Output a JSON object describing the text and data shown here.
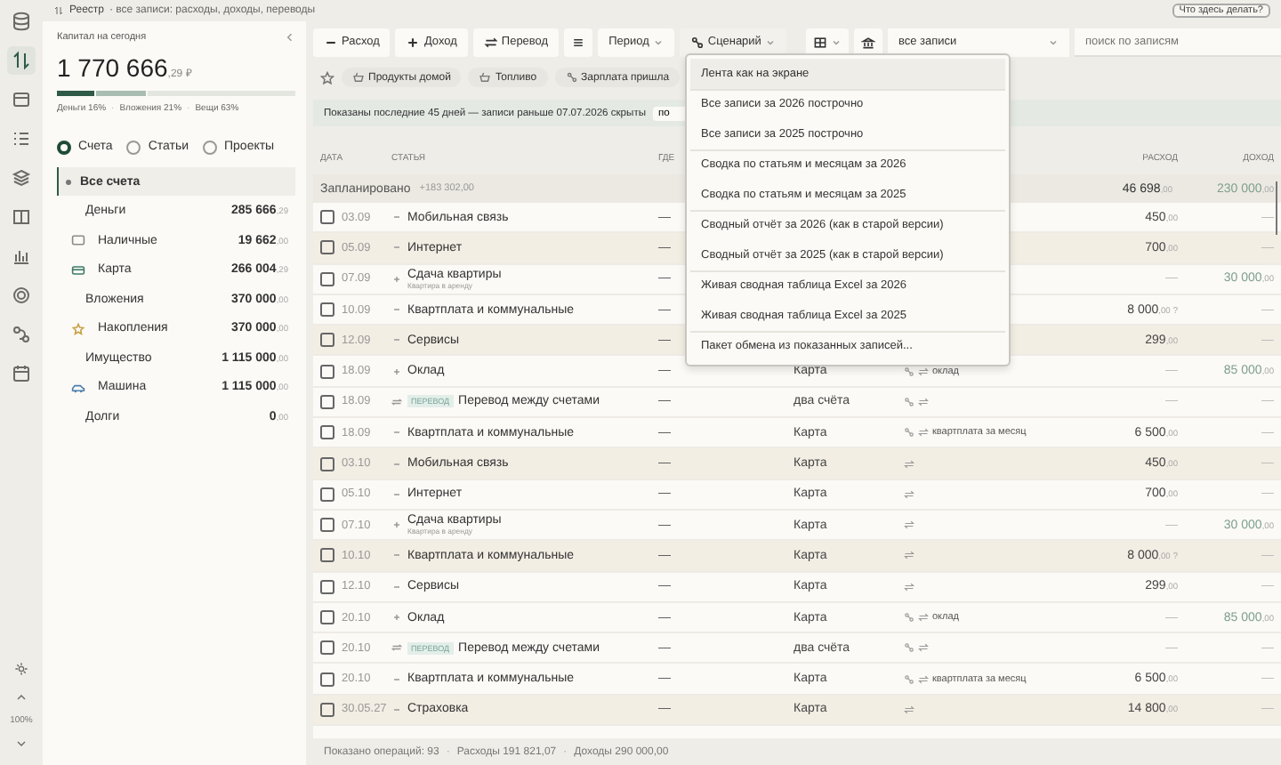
{
  "header": {
    "title": "Реестр",
    "subtitle": "· все записи: расходы, доходы, переводы",
    "help_button": "Что здесь делать?"
  },
  "rail": {
    "items": [
      {
        "selected": false
      },
      {
        "selected": true
      },
      {
        "selected": false
      },
      {
        "selected": false
      },
      {
        "selected": false
      },
      {
        "selected": false
      },
      {
        "selected": false
      },
      {
        "selected": false
      },
      {
        "selected": false
      },
      {
        "selected": false
      }
    ],
    "zoom": "100%"
  },
  "separator": "·",
  "capital": {
    "label": "Капитал на сегодня",
    "amount": "1 770 666",
    "cents": ",29 ₽",
    "segments": [
      {
        "label": "Деньги 16%",
        "level": 0.16,
        "color": "#2f5a48"
      },
      {
        "label": "Вложения 21%",
        "level": 0.21,
        "color": "#a9bdb2"
      },
      {
        "label": "Вещи 63%",
        "level": 0.63,
        "color": "#e3e6df"
      }
    ]
  },
  "views": [
    {
      "label": "Счета",
      "selected": true
    },
    {
      "label": "Статьи",
      "selected": false
    },
    {
      "label": "Проекты",
      "selected": false
    }
  ],
  "accounts": [
    {
      "label": "Все счета",
      "selected": true,
      "kind": "all"
    },
    {
      "label": "Деньги",
      "amount": "285 666",
      "cents": ",29",
      "selected": false,
      "kind": "group",
      "children": [
        {
          "label": "Наличные",
          "amount": "19 662",
          "cents": ",00",
          "selected": false,
          "kind": "cash"
        },
        {
          "label": "Карта",
          "amount": "266 004",
          "cents": ",29",
          "selected": false,
          "kind": "card"
        }
      ]
    },
    {
      "label": "Вложения",
      "amount": "370 000",
      "cents": ",00",
      "selected": false,
      "kind": "group",
      "children": [
        {
          "label": "Накопления",
          "amount": "370 000",
          "cents": ",00",
          "selected": false,
          "kind": "savings"
        }
      ]
    },
    {
      "label": "Имущество",
      "amount": "1 115 000",
      "cents": ",00",
      "selected": false,
      "kind": "group",
      "children": [
        {
          "label": "Машина",
          "amount": "1 115 000",
          "cents": ",00",
          "selected": false,
          "kind": "car"
        }
      ]
    },
    {
      "label": "Долги",
      "amount": "0",
      "cents": ",00",
      "selected": false,
      "kind": "group"
    }
  ],
  "toolbar": {
    "expense": "Расход",
    "income": "Доход",
    "transfer": "Перевод",
    "period": "Период",
    "scenario": "Сценарий",
    "filter": "все записи",
    "search_placeholder": "поиск по записям"
  },
  "favorites": [
    {
      "label": "Продукты домой",
      "kind": "basket"
    },
    {
      "label": "Топливо",
      "kind": "basket"
    },
    {
      "label": "Зарплата пришла",
      "kind": "link"
    }
  ],
  "notice": {
    "text": "Показаны последние 45 дней — записи раньше 07.07.2026 скрыты",
    "button": "по"
  },
  "table": {
    "columns": [
      "ДАТА",
      "СТАТЬЯ",
      "ГДЕ",
      "РАСХОД",
      "ДОХОД"
    ],
    "group": {
      "label": "Запланировано",
      "total": "+183 302,00",
      "expense": {
        "whole": "46 698",
        "cents": ",00"
      },
      "income": {
        "whole": "230 000",
        "cents": ",00"
      }
    },
    "rows": [
      {
        "date": "03.09",
        "kind": "expense",
        "title": "Мобильная связь",
        "where": "—",
        "shaded": false,
        "expense": {
          "whole": "450",
          "cents": ",00"
        },
        "income": {
          "whole": "—"
        }
      },
      {
        "date": "05.09",
        "kind": "expense",
        "title": "Интернет",
        "where": "—",
        "shaded": true,
        "expense": {
          "whole": "700",
          "cents": ",00"
        },
        "income": {
          "whole": "—"
        }
      },
      {
        "date": "07.09",
        "kind": "income",
        "title": "Сдача квартиры",
        "note": "Квартира в аренду",
        "where": "—",
        "shaded": false,
        "expense": {
          "whole": "—"
        },
        "income": {
          "whole": "30 000",
          "cents": ",00"
        }
      },
      {
        "date": "10.09",
        "kind": "expense",
        "title": "Квартплата и коммунальные",
        "where": "—",
        "shaded": false,
        "expense": {
          "whole": "8 000",
          "cents": ",00",
          "mark": "?"
        },
        "income": {
          "whole": "—"
        }
      },
      {
        "date": "12.09",
        "kind": "expense",
        "title": "Сервисы",
        "where": "—",
        "shaded": true,
        "expense": {
          "whole": "299",
          "cents": ",00"
        },
        "income": {
          "whole": "—"
        }
      },
      {
        "date": "18.09",
        "kind": "income",
        "title": "Оклад",
        "where": "—",
        "account": "Карта",
        "linked": true,
        "recurring": true,
        "tag": "оклад",
        "shaded": false,
        "expense": {
          "whole": "—"
        },
        "income": {
          "whole": "85 000",
          "cents": ",00"
        }
      },
      {
        "date": "18.09",
        "kind": "transfer",
        "badge": "ПЕРЕВОД",
        "title": "Перевод между счетами",
        "where": "—",
        "account": "два счёта",
        "linked": true,
        "recurring": true,
        "shaded": false,
        "expense": {
          "whole": "—"
        },
        "income": {
          "whole": "—"
        }
      },
      {
        "date": "18.09",
        "kind": "expense",
        "title": "Квартплата и коммунальные",
        "where": "—",
        "account": "Карта",
        "linked": true,
        "recurring": true,
        "tag": "квартплата за месяц",
        "shaded": false,
        "expense": {
          "whole": "6 500",
          "cents": ",00"
        },
        "income": {
          "whole": "—"
        }
      },
      {
        "date": "03.10",
        "kind": "expense",
        "title": "Мобильная связь",
        "where": "—",
        "account": "Карта",
        "linked": false,
        "recurring": true,
        "shaded": true,
        "expense": {
          "whole": "450",
          "cents": ",00"
        },
        "income": {
          "whole": "—"
        }
      },
      {
        "date": "05.10",
        "kind": "expense",
        "title": "Интернет",
        "where": "—",
        "account": "Карта",
        "linked": false,
        "recurring": true,
        "shaded": false,
        "expense": {
          "whole": "700",
          "cents": ",00"
        },
        "income": {
          "whole": "—"
        }
      },
      {
        "date": "07.10",
        "kind": "income",
        "title": "Сдача квартиры",
        "note": "Квартира в аренду",
        "where": "—",
        "account": "Карта",
        "linked": false,
        "recurring": true,
        "shaded": false,
        "expense": {
          "whole": "—"
        },
        "income": {
          "whole": "30 000",
          "cents": ",00"
        }
      },
      {
        "date": "10.10",
        "kind": "expense",
        "title": "Квартплата и коммунальные",
        "where": "—",
        "account": "Карта",
        "linked": false,
        "recurring": true,
        "shaded": true,
        "expense": {
          "whole": "8 000",
          "cents": ",00",
          "mark": "?"
        },
        "income": {
          "whole": "—"
        }
      },
      {
        "date": "12.10",
        "kind": "expense",
        "title": "Сервисы",
        "where": "—",
        "account": "Карта",
        "linked": false,
        "recurring": true,
        "shaded": false,
        "expense": {
          "whole": "299",
          "cents": ",00"
        },
        "income": {
          "whole": "—"
        }
      },
      {
        "date": "20.10",
        "kind": "income",
        "title": "Оклад",
        "where": "—",
        "account": "Карта",
        "linked": true,
        "recurring": true,
        "tag": "оклад",
        "shaded": false,
        "expense": {
          "whole": "—"
        },
        "income": {
          "whole": "85 000",
          "cents": ",00"
        }
      },
      {
        "date": "20.10",
        "kind": "transfer",
        "badge": "ПЕРЕВОД",
        "title": "Перевод между счетами",
        "where": "—",
        "account": "два счёта",
        "linked": true,
        "recurring": true,
        "shaded": false,
        "expense": {
          "whole": "—"
        },
        "income": {
          "whole": "—"
        }
      },
      {
        "date": "20.10",
        "kind": "expense",
        "title": "Квартплата и коммунальные",
        "where": "—",
        "account": "Карта",
        "linked": true,
        "recurring": true,
        "tag": "квартплата за месяц",
        "shaded": false,
        "expense": {
          "whole": "6 500",
          "cents": ",00"
        },
        "income": {
          "whole": "—"
        }
      },
      {
        "date": "30.05.27",
        "kind": "expense",
        "title": "Страховка",
        "where": "—",
        "account": "Карта",
        "linked": false,
        "recurring": true,
        "shaded": true,
        "expense": {
          "whole": "14 800",
          "cents": ",00"
        },
        "income": {
          "whole": "—"
        }
      }
    ]
  },
  "status_bar": [
    "Показано операций: 93",
    "Расходы 191 821,07",
    "Доходы 290 000,00"
  ],
  "scenario_menu": [
    [
      {
        "label": "Лента как на экране",
        "selected": true
      }
    ],
    [
      {
        "label": "Все записи за 2026 построчно",
        "selected": false
      },
      {
        "label": "Все записи за 2025 построчно",
        "selected": false
      }
    ],
    [
      {
        "label": "Сводка по статьям и месяцам за 2026",
        "selected": false
      },
      {
        "label": "Сводка по статьям и месяцам за 2025",
        "selected": false
      }
    ],
    [
      {
        "label": "Сводный отчёт за 2026 (как в старой версии)",
        "selected": false
      },
      {
        "label": "Сводный отчёт за 2025 (как в старой версии)",
        "selected": false
      }
    ],
    [
      {
        "label": "Живая сводная таблица Excel за 2026",
        "selected": false
      },
      {
        "label": "Живая сводная таблица Excel за 2025",
        "selected": false
      }
    ],
    [
      {
        "label": "Пакет обмена из показанных записей...",
        "selected": false
      }
    ]
  ]
}
